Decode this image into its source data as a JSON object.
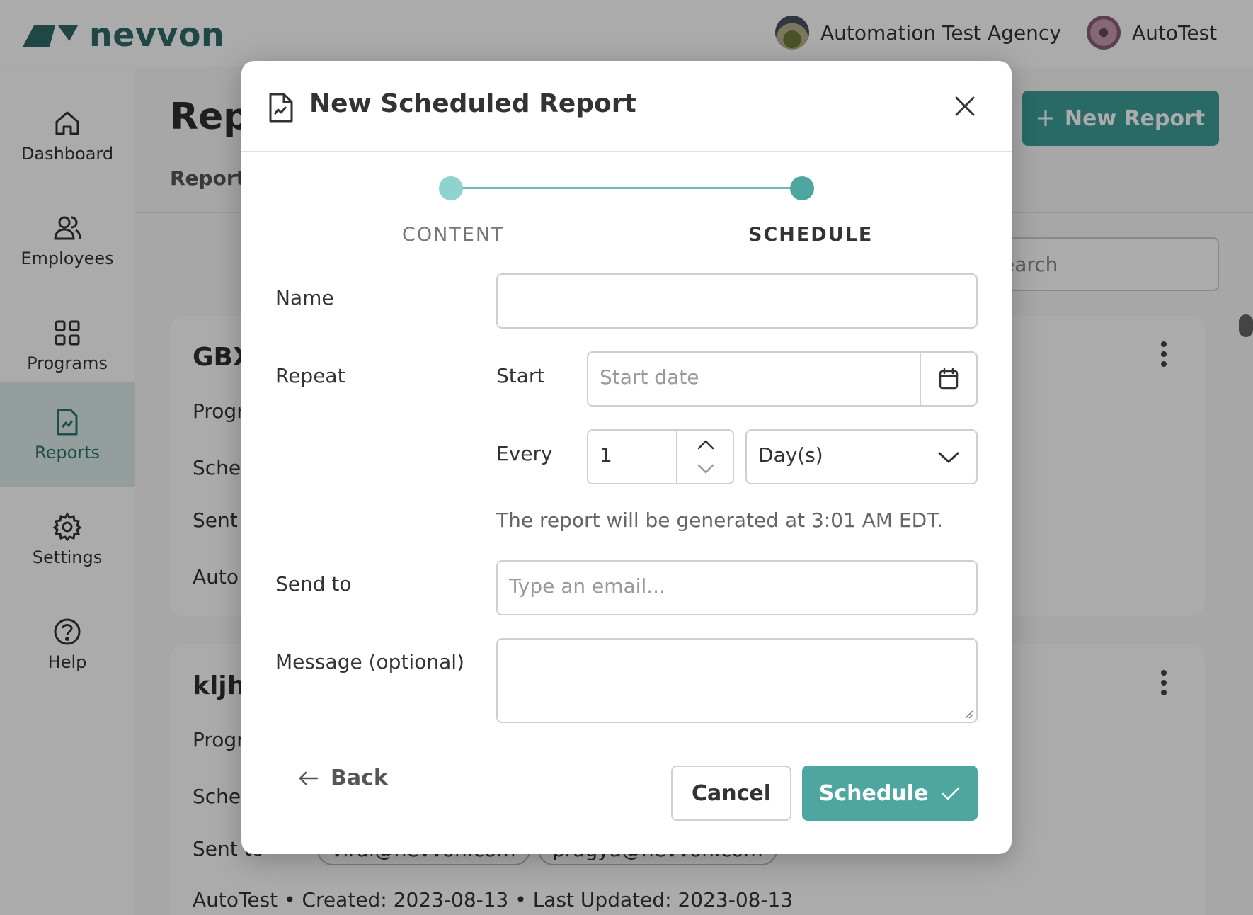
{
  "header": {
    "brand": "nevvon",
    "agency_name": "Automation Test Agency",
    "user_name": "AutoTest"
  },
  "sidebar": {
    "items": [
      {
        "label": "Dashboard",
        "icon": "home-icon"
      },
      {
        "label": "Employees",
        "icon": "users-icon"
      },
      {
        "label": "Programs",
        "icon": "grid-icon"
      },
      {
        "label": "Reports",
        "icon": "report-icon",
        "active": true
      },
      {
        "label": "Settings",
        "icon": "gear-icon"
      },
      {
        "label": "Help",
        "icon": "help-icon"
      }
    ]
  },
  "page": {
    "title": "Repo",
    "tab": "Reports",
    "new_report_label": "New Report",
    "search_placeholder": "earch"
  },
  "cards": [
    {
      "title": "GBX",
      "lines": [
        "Progr",
        "Sche",
        "Sent",
        "Auto"
      ]
    },
    {
      "title": "kljhl",
      "lines": [
        "Progr",
        "Sche",
        "Sent to"
      ],
      "chips": [
        "viral@nevvon.com",
        "pragya@nevvon.com"
      ],
      "meta": {
        "owner": "AutoTest",
        "created_label": "Created:",
        "created": "2023-08-13",
        "updated_label": "Last Updated:",
        "updated": "2023-08-13"
      }
    }
  ],
  "modal": {
    "title": "New Scheduled Report",
    "steps": [
      "CONTENT",
      "SCHEDULE"
    ],
    "active_step": "SCHEDULE",
    "fields": {
      "name_label": "Name",
      "name_value": "",
      "repeat_label": "Repeat",
      "start_label": "Start",
      "start_placeholder": "Start date",
      "every_label": "Every",
      "every_value": "1",
      "unit_value": "Day(s)",
      "hint": "The report will be generated at 3:01 AM EDT.",
      "send_to_label": "Send to",
      "email_placeholder": "Type an email...",
      "message_label": "Message (optional)",
      "message_value": ""
    },
    "buttons": {
      "back": "Back",
      "cancel": "Cancel",
      "schedule": "Schedule"
    }
  },
  "colors": {
    "accent": "#4ea6a1",
    "brand": "#2d6b68",
    "step_inactive": "#8fd3ce"
  }
}
